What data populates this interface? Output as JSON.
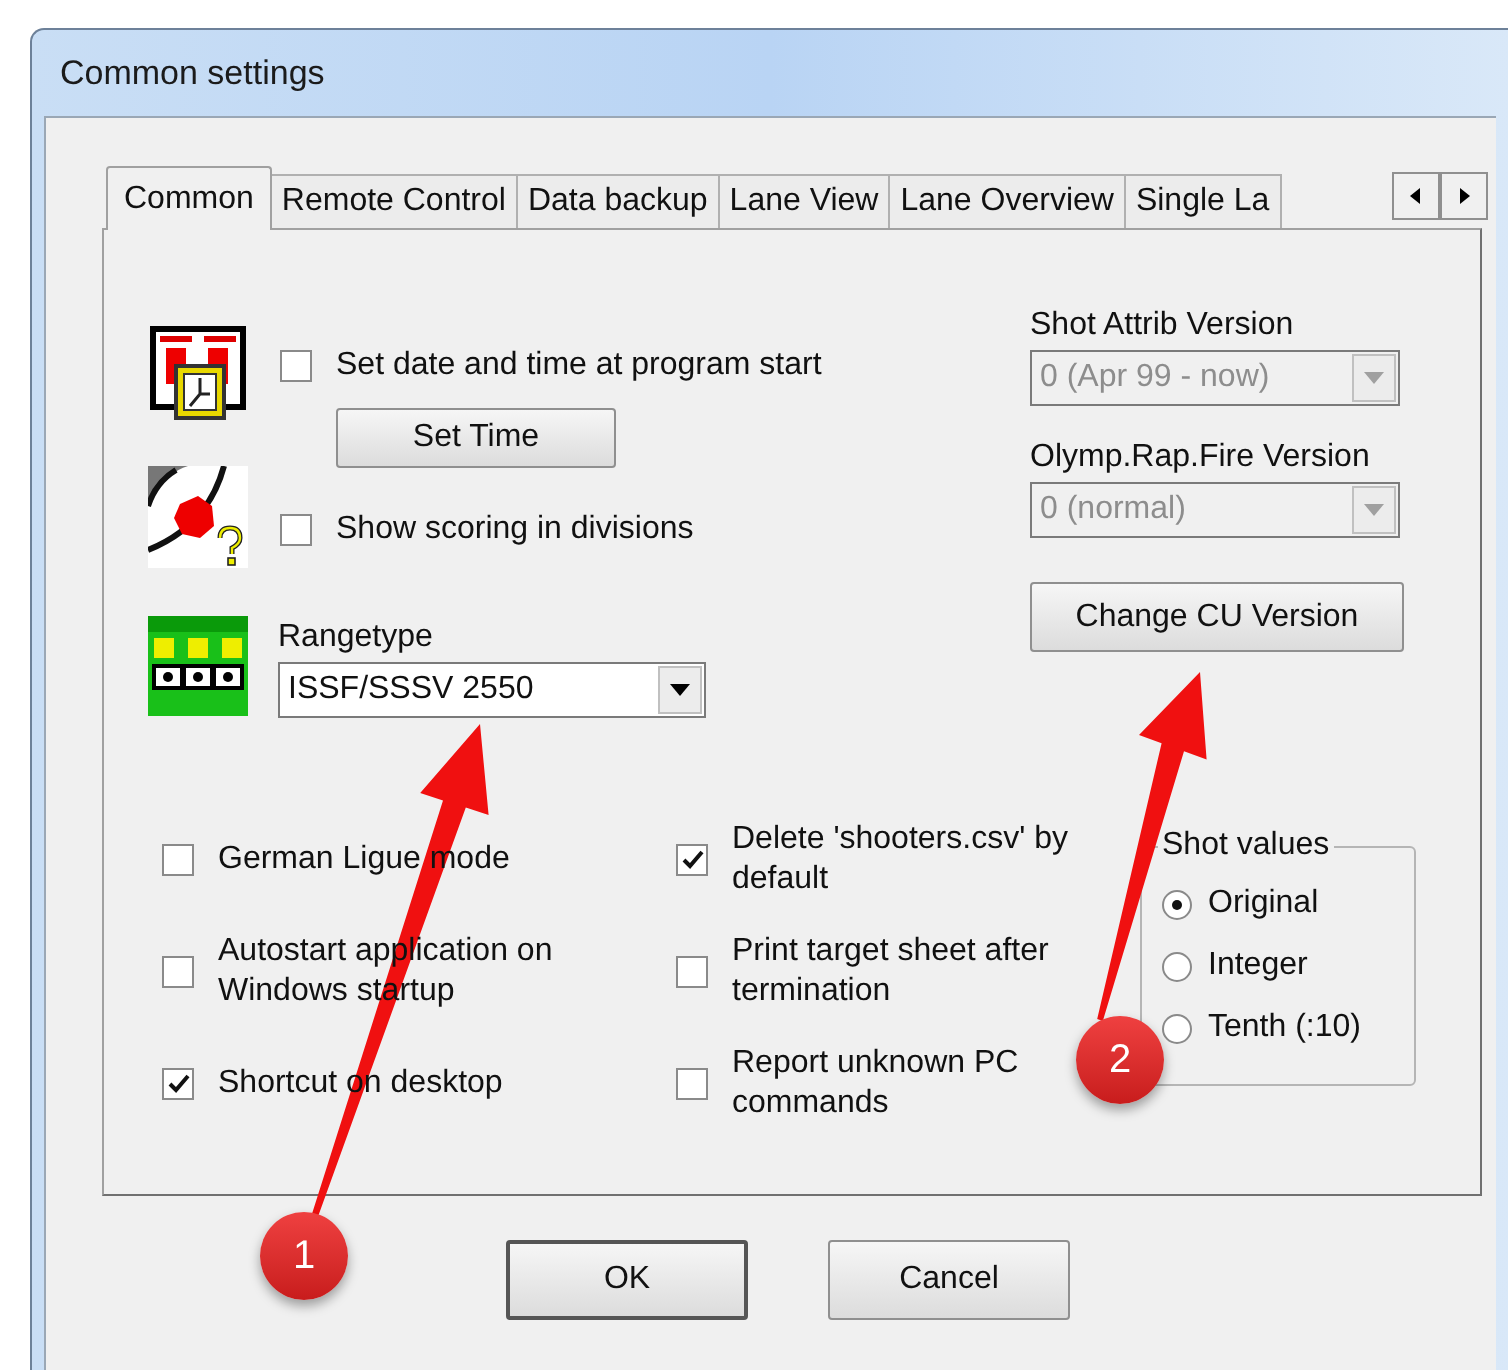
{
  "window": {
    "title": "Common settings"
  },
  "tabs": [
    {
      "label": "Common",
      "selected": true
    },
    {
      "label": "Remote Control",
      "selected": false
    },
    {
      "label": "Data backup",
      "selected": false
    },
    {
      "label": "Lane View",
      "selected": false
    },
    {
      "label": "Lane Overview",
      "selected": false
    },
    {
      "label": "Single La",
      "selected": false
    }
  ],
  "date_time": {
    "label": "Set date and time at program start",
    "checked": false,
    "button": "Set Time"
  },
  "scoring": {
    "label": "Show scoring in divisions",
    "checked": false
  },
  "rangetype": {
    "label": "Rangetype",
    "value": "ISSF/SSSV 2550",
    "disabled": false
  },
  "versions": [
    {
      "label": "Shot Attrib Version",
      "value": "0 (Apr 99 - now)",
      "disabled": true
    },
    {
      "label": "Olymp.Rap.Fire Version",
      "value": "0 (normal)",
      "disabled": true
    }
  ],
  "change_cu_button": "Change CU Version",
  "checkboxes": [
    {
      "label": "German Ligue mode",
      "checked": false
    },
    {
      "label": "Autostart application on Windows startup",
      "checked": false
    },
    {
      "label": "Shortcut on desktop",
      "checked": true
    },
    {
      "label": "Delete 'shooters.csv' by default",
      "checked": true
    },
    {
      "label": "Print target sheet after termination",
      "checked": false
    },
    {
      "label": "Report unknown PC commands",
      "checked": false
    }
  ],
  "shot_values": {
    "title": "Shot values",
    "options": [
      {
        "label": "Original",
        "selected": true
      },
      {
        "label": "Integer",
        "selected": false
      },
      {
        "label": "Tenth (:10)",
        "selected": false
      }
    ]
  },
  "buttons": [
    {
      "label": "OK",
      "default": true
    },
    {
      "label": "Cancel",
      "default": false
    }
  ],
  "annotations": [
    {
      "number": "1"
    },
    {
      "number": "2"
    }
  ]
}
